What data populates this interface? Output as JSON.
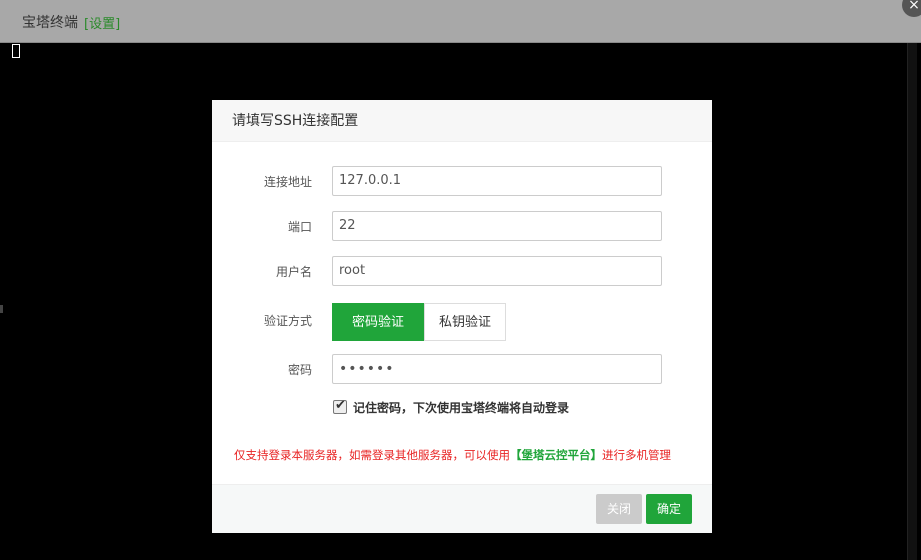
{
  "window": {
    "title": "宝塔终端",
    "settings_link": "[设置]",
    "close_glyph": "×"
  },
  "dialog": {
    "title": "请填写SSH连接配置",
    "fields": {
      "address": {
        "label": "连接地址",
        "value": "127.0.0.1"
      },
      "port": {
        "label": "端口",
        "value": "22"
      },
      "username": {
        "label": "用户名",
        "value": "root"
      },
      "auth": {
        "label": "验证方式",
        "options": [
          "密码验证",
          "私钥验证"
        ],
        "selected": "密码验证"
      },
      "password": {
        "label": "密码",
        "value": "••••••"
      }
    },
    "remember": {
      "checked": true,
      "label": "记住密码，下次使用宝塔终端将自动登录"
    },
    "notice": {
      "prefix": "仅支持登录本服务器，如需登录其他服务器，可以使用",
      "link": "【堡塔云控平台】",
      "suffix": "进行多机管理"
    },
    "buttons": {
      "close": "关闭",
      "confirm": "确定"
    }
  },
  "colors": {
    "accent": "#20a53a",
    "notice": "#e82424",
    "disabled_button": "#cbcbcb"
  }
}
